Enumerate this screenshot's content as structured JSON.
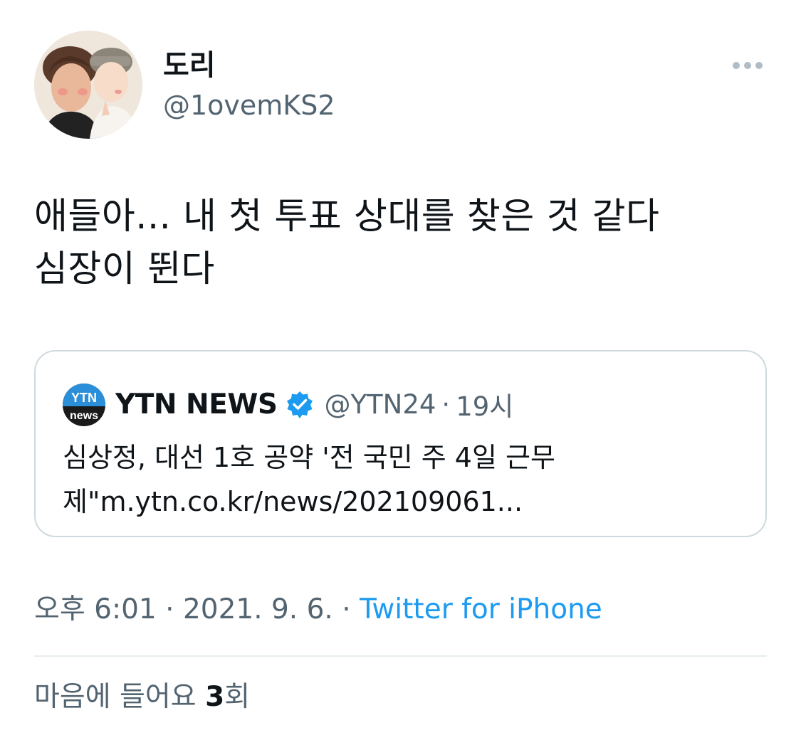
{
  "author": {
    "display_name": "도리",
    "handle": "@1ovemKS2"
  },
  "tweet": {
    "text": "애들아... 내 첫 투표 상대를 찾은 것 같다\n심장이 뛴다"
  },
  "quoted_tweet": {
    "name": "YTN NEWS",
    "handle": "@YTN24",
    "separator": "·",
    "time": "19시",
    "text": "심상정, 대선 1호 공약 '전 국민 주 4일 근무\n제\"m.ytn.co.kr/news/202109061...",
    "logo_text_top": "YTN",
    "logo_text_bottom": "news"
  },
  "meta": {
    "time": "오후 6:01",
    "sep1": " · ",
    "date": "2021. 9. 6.",
    "sep2": " · ",
    "source": "Twitter for iPhone"
  },
  "likes": {
    "prefix": "마음에 들어요 ",
    "count": "3",
    "suffix": "회"
  },
  "colors": {
    "link": "#1d9bf0",
    "secondary": "#536471",
    "border": "#cfd9de"
  },
  "icons": [
    "more-icon",
    "verified-icon",
    "avatar"
  ]
}
